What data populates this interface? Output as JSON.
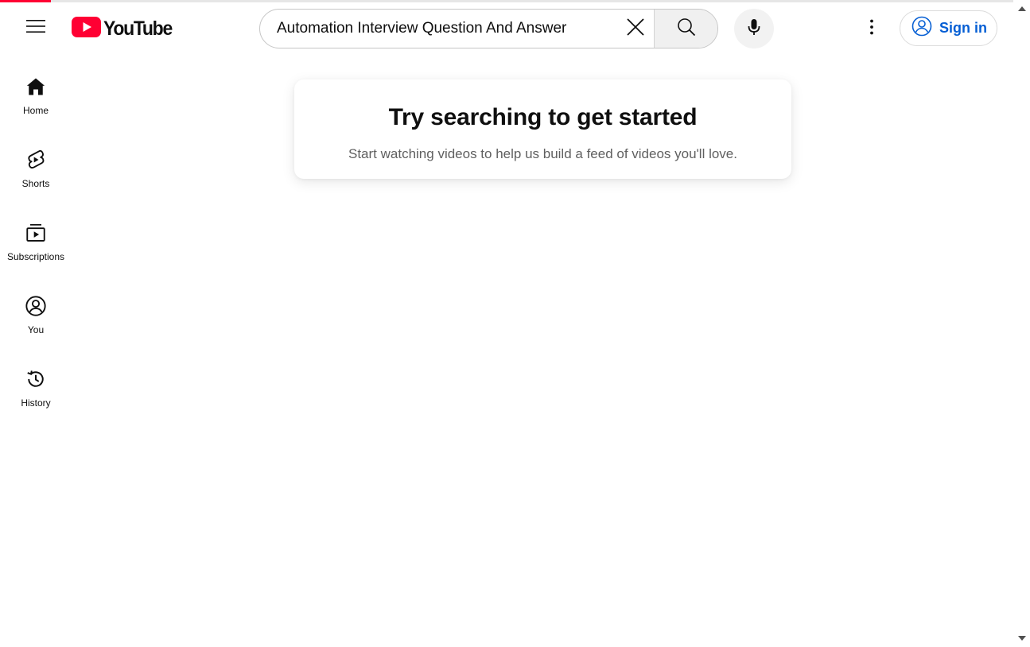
{
  "loading_bar": {
    "progress_fraction": 0.05,
    "color": "#ff0033"
  },
  "header": {
    "logo_text": "YouTube",
    "logo_color": "#ff0033",
    "search": {
      "value": "Automation Interview Question And Answer",
      "placeholder": "Search"
    },
    "sign_in_label": "Sign in",
    "sign_in_color": "#065fd4",
    "icons": [
      "menu-icon",
      "youtube-logo-icon",
      "clear-icon",
      "search-icon",
      "microphone-icon",
      "more-vert-icon",
      "account-circle-icon"
    ]
  },
  "sidebar": {
    "items": [
      {
        "label": "Home",
        "icon": "home-icon"
      },
      {
        "label": "Shorts",
        "icon": "shorts-icon"
      },
      {
        "label": "Subscriptions",
        "icon": "subscriptions-icon"
      },
      {
        "label": "You",
        "icon": "you-icon"
      },
      {
        "label": "History",
        "icon": "history-icon"
      }
    ]
  },
  "main": {
    "prompt_title": "Try searching to get started",
    "prompt_subtitle": "Start watching videos to help us build a feed of videos you'll love."
  }
}
